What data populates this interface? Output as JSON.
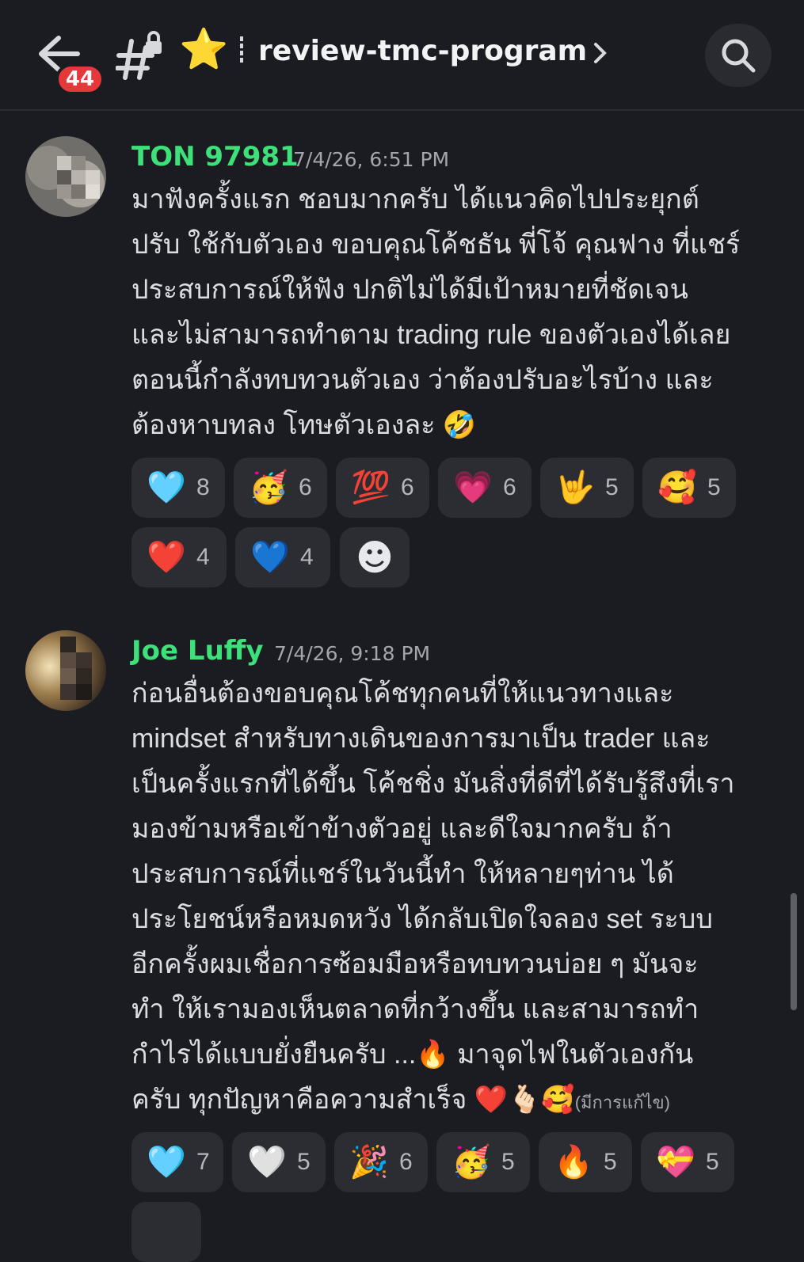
{
  "header": {
    "badge_count": "44",
    "channel_name": "review-tmc-program",
    "star_emoji": "⭐"
  },
  "messages": [
    {
      "username": "TON 97981",
      "timestamp": "7/4/26, 6:51 PM",
      "lines": [
        "มาฟังครั้งแรก ชอบมากครับ ได้แนวคิดไปประยุกต์",
        "ปรับ ใช้กับตัวเอง ขอบคุณโค้ชธัน พี่โจ้ คุณฟาง ที่แชร์",
        "ประสบการณ์ให้ฟัง ปกติไม่ได้มีเป้าหมายที่ชัดเจน",
        "และไม่สามารถทำตาม trading rule ของตัวเองได้เลย",
        "ตอนนี้กำลังทบทวนตัวเอง ว่าต้องปรับอะไรบ้าง และ",
        "ต้องหาบทลง โทษตัวเองละ 🤣"
      ],
      "reactions": [
        {
          "emoji": "🩵",
          "count": "8",
          "color": "#6ad1f5"
        },
        {
          "emoji": "🥳",
          "count": "6",
          "color": "#f6c343"
        },
        {
          "emoji": "💯",
          "count": "6",
          "color": "#e5383b"
        },
        {
          "emoji": "💗",
          "count": "6",
          "color": "#f03fa8"
        },
        {
          "emoji": "🤟",
          "count": "5",
          "color": "#f6c343"
        },
        {
          "emoji": "🥰",
          "count": "5",
          "color": "#f6c343"
        },
        {
          "emoji": "❤️",
          "count": "4",
          "color": "#e5383b"
        },
        {
          "emoji": "💙",
          "count": "4",
          "color": "#2f7ff0"
        },
        {
          "emoji": "☻",
          "count": "",
          "color": "#e8e9ec"
        }
      ]
    },
    {
      "username": "Joe Luffy",
      "timestamp": "7/4/26, 9:18 PM",
      "lines": [
        "ก่อนอื่นต้องขอบคุณโค้ชทุกคนที่ให้แนวทางและ",
        "mindset สำหรับทางเดินของการมาเป็น trader และ",
        "เป็นครั้งแรกที่ได้ขึ้น โค้ชชิ่ง มันสิ่งที่ดีที่ได้รับรู้สึงที่เรา",
        "มองข้ามหรือเข้าข้างตัวอยู่ และดีใจมากครับ ถ้า",
        "ประสบการณ์ที่แชร์ในวันนี้ทำ ให้หลายๆท่าน ได้",
        "ประโยชน์หรือหมดหวัง ได้กลับเปิดใจลอง set ระบบ",
        "อีกครั้งผมเชื่อการซ้อมมือหรือทบทวนบ่อย ๆ มันจะ",
        "ทำ ให้เรามองเห็นตลาดที่กว้างขึ้น และสามารถทำ",
        "กำไรได้แบบยั่งยืนครับ ...🔥 มาจุดไฟในตัวเองกัน",
        "ครับ  ทุกปัญหาคือความสำเร็จ  ❤️🫰🏻🥰"
      ],
      "edited_label": "(มีการแก้ไข)",
      "reactions": [
        {
          "emoji": "🩵",
          "count": "7",
          "color": "#6ad1f5"
        },
        {
          "emoji": "🤍",
          "count": "5",
          "color": "#f2f3f5"
        },
        {
          "emoji": "🎉",
          "count": "6",
          "color": "#f6c343"
        },
        {
          "emoji": "🥳",
          "count": "5",
          "color": "#f6c343"
        },
        {
          "emoji": "🔥",
          "count": "5",
          "color": "#f58a1f"
        },
        {
          "emoji": "💝",
          "count": "5",
          "color": "#f03fa8"
        }
      ]
    }
  ]
}
